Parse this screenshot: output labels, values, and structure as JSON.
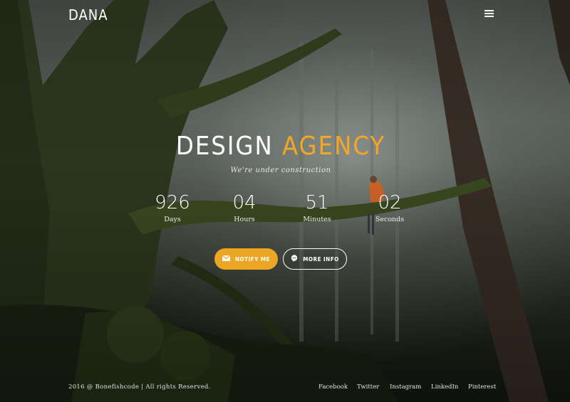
{
  "brand": {
    "logo": "DANA"
  },
  "header": {
    "menu_icon": "hamburger-menu-icon"
  },
  "hero": {
    "title_main": "DESIGN",
    "title_accent": "AGENCY",
    "subtitle": "We're under construction",
    "accent_color": "#f5a623"
  },
  "countdown": [
    {
      "value": "926",
      "label": "Days"
    },
    {
      "value": "04",
      "label": "Hours"
    },
    {
      "value": "51",
      "label": "Minutes"
    },
    {
      "value": "02",
      "label": "Seconds"
    }
  ],
  "buttons": {
    "notify": {
      "label": "NOTIFY ME",
      "icon": "envelope-icon",
      "color": "#eba624"
    },
    "info": {
      "label": "MORE INFO",
      "icon": "speech-bubble-icon"
    }
  },
  "footer": {
    "copyright": "2016 @ Bonefishcode | All rights Reserved.",
    "links": [
      "Facebook",
      "Twitter",
      "Instagram",
      "LinkedIn",
      "Pinterest"
    ]
  }
}
